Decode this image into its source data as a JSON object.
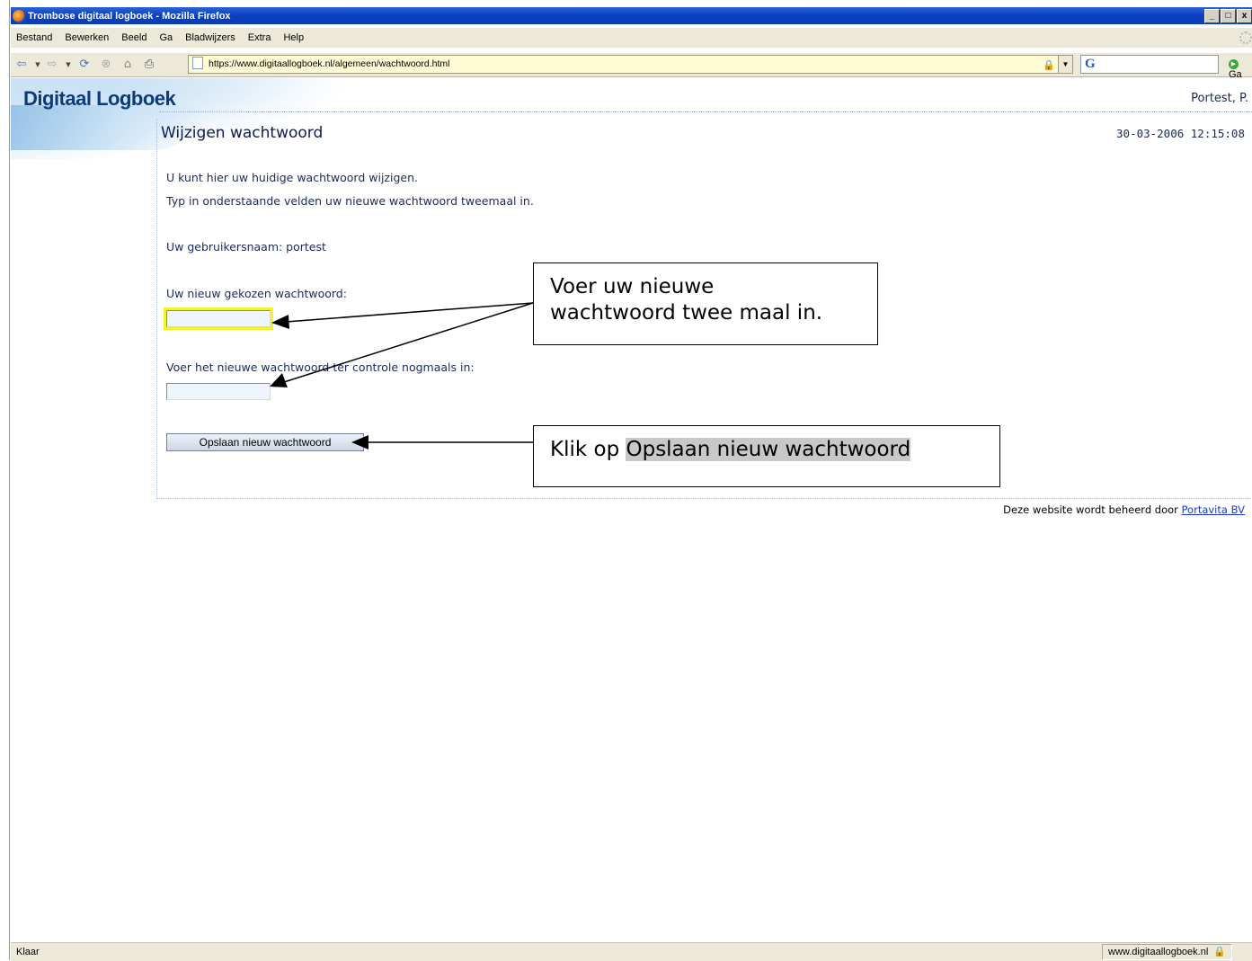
{
  "window": {
    "title": "Trombose digitaal logboek - Mozilla Firefox",
    "minimize": "_",
    "maximize": "□",
    "close": "x"
  },
  "menu": {
    "items": [
      {
        "label": "Bestand"
      },
      {
        "label": "Bewerken"
      },
      {
        "label": "Beeld"
      },
      {
        "label": "Ga"
      },
      {
        "label": "Bladwijzers"
      },
      {
        "label": "Extra"
      },
      {
        "label": "Help"
      }
    ]
  },
  "nav": {
    "url": "https://www.digitaallogboek.nl/algemeen/wachtwoord.html",
    "search_value": "",
    "go_label": "Ga",
    "icons": [
      "back-icon",
      "forward-icon",
      "reload-icon",
      "stop-icon",
      "home-icon",
      "print-icon"
    ]
  },
  "page": {
    "logo": "Digitaal Logboek",
    "user": "Portest, P.",
    "title": "Wijzigen wachtwoord",
    "datetime": "30-03-2006 12:15:08",
    "intro1": "U kunt hier uw huidige wachtwoord wijzigen.",
    "intro2": "Typ in onderstaande velden uw nieuwe wachtwoord tweemaal in.",
    "username_line": "Uw gebruikersnaam: portest",
    "new_password_label": "Uw nieuw gekozen wachtwoord:",
    "new_password_value": "",
    "confirm_password_label": "Voer het nieuwe wachtwoord ter controle nogmaals in:",
    "confirm_password_value": "",
    "save_button": "Opslaan nieuw wachtwoord",
    "footer_text": "Deze website wordt beheerd door ",
    "footer_link": "Portavita BV"
  },
  "annotations": {
    "callout1_line1": "Voer uw nieuwe",
    "callout1_line2": "wachtwoord twee maal in.",
    "callout2_prefix": "Klik op ",
    "callout2_highlight": "Opslaan nieuw wachtwoord"
  },
  "status": {
    "left": "Klaar",
    "right": "www.digitaallogboek.nl"
  },
  "colors": {
    "title_bar": "#0a3fc0",
    "url_bar_bg": "#fffbd4",
    "focus_highlight": "#f3f32a",
    "link": "#1a3acc",
    "heading": "#0d1a4d"
  }
}
